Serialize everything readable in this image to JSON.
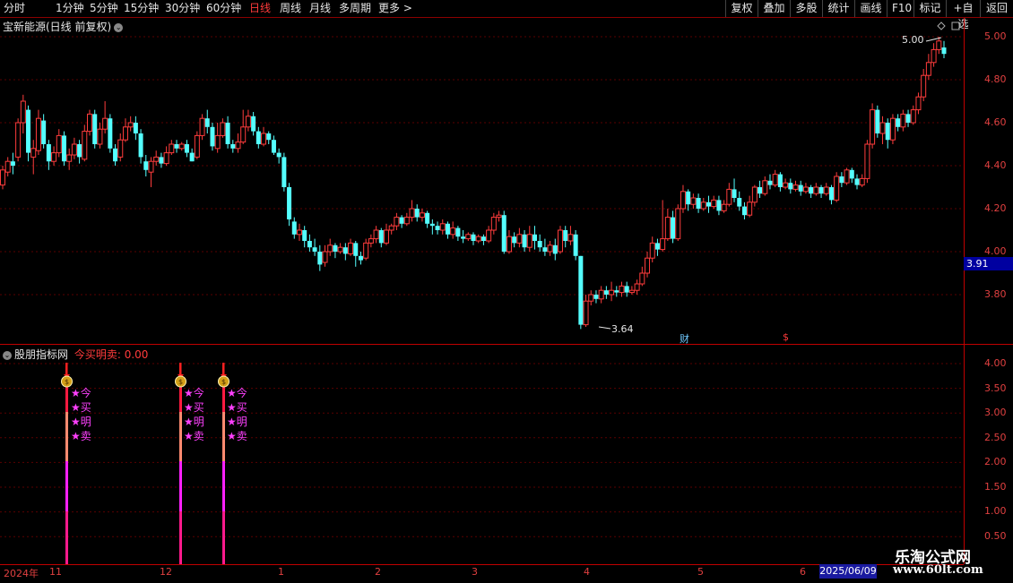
{
  "toolbar": {
    "periods": [
      "分时",
      "1分钟",
      "5分钟",
      "15分钟",
      "30分钟",
      "60分钟",
      "日线",
      "周线",
      "月线",
      "多周期",
      "更多 >"
    ],
    "active_period": "日线",
    "right_buttons": [
      "复权",
      "叠加",
      "多股",
      "统计",
      "画线",
      "F10",
      "标记",
      "+自选",
      "返回"
    ]
  },
  "main_chart": {
    "title": "宝新能源(日线 前复权)",
    "price_axis": [
      "5.00",
      "4.80",
      "4.60",
      "4.40",
      "4.20",
      "4.00",
      "3.80"
    ],
    "current_price": "3.91",
    "high_label": "5.00",
    "low_label": "3.64",
    "markers": {
      "cai": "财",
      "dollar": "$"
    },
    "colors": {
      "up": "#ff3c3c",
      "down": "#54ffff",
      "grid": "#5a0000",
      "axis": "#e04040"
    }
  },
  "indicator": {
    "name": "股朋指标网",
    "label": "今买明卖: 0.00",
    "axis": [
      "4.00",
      "3.50",
      "3.00",
      "2.50",
      "2.00",
      "1.50",
      "1.00",
      "0.50"
    ],
    "signal_chars": [
      "★今",
      "★买",
      "★明",
      "★卖"
    ]
  },
  "date_axis": {
    "year": "2024年",
    "months": [
      "11",
      "12",
      "1",
      "2",
      "3",
      "4",
      "5",
      "6"
    ],
    "current_date": "2025/06/09"
  },
  "watermark": {
    "line1": "乐淘公式网",
    "line2": "www.60lt.com"
  },
  "chart_data": {
    "type": "candlestick",
    "ylim": [
      3.55,
      5.05
    ],
    "candles": [
      [
        4.31,
        4.38,
        4.29,
        4.4
      ],
      [
        4.37,
        4.42,
        4.35,
        4.44
      ],
      [
        4.42,
        4.4,
        4.36,
        4.46
      ],
      [
        4.44,
        4.6,
        4.42,
        4.62
      ],
      [
        4.6,
        4.7,
        4.55,
        4.73
      ],
      [
        4.66,
        4.46,
        4.42,
        4.68
      ],
      [
        4.44,
        4.48,
        4.36,
        4.52
      ],
      [
        4.47,
        4.62,
        4.45,
        4.66
      ],
      [
        4.61,
        4.5,
        4.48,
        4.64
      ],
      [
        4.5,
        4.42,
        4.38,
        4.52
      ],
      [
        4.42,
        4.46,
        4.4,
        4.49
      ],
      [
        4.46,
        4.54,
        4.44,
        4.57
      ],
      [
        4.54,
        4.42,
        4.4,
        4.56
      ],
      [
        4.42,
        4.45,
        4.38,
        4.48
      ],
      [
        4.45,
        4.5,
        4.43,
        4.53
      ],
      [
        4.5,
        4.44,
        4.41,
        4.52
      ],
      [
        4.43,
        4.56,
        4.42,
        4.59
      ],
      [
        4.56,
        4.64,
        4.54,
        4.66
      ],
      [
        4.64,
        4.5,
        4.48,
        4.66
      ],
      [
        4.5,
        4.57,
        4.48,
        4.6
      ],
      [
        4.57,
        4.62,
        4.55,
        4.7
      ],
      [
        4.62,
        4.48,
        4.46,
        4.64
      ],
      [
        4.48,
        4.42,
        4.4,
        4.5
      ],
      [
        4.44,
        4.52,
        4.42,
        4.55
      ],
      [
        4.52,
        4.58,
        4.51,
        4.62
      ],
      [
        4.58,
        4.6,
        4.56,
        4.63
      ],
      [
        4.6,
        4.55,
        4.52,
        4.63
      ],
      [
        4.55,
        4.44,
        4.41,
        4.57
      ],
      [
        4.42,
        4.38,
        4.35,
        4.45
      ],
      [
        4.37,
        4.42,
        4.3,
        4.44
      ],
      [
        4.42,
        4.44,
        4.4,
        4.47
      ],
      [
        4.44,
        4.41,
        4.39,
        4.46
      ],
      [
        4.41,
        4.46,
        4.4,
        4.49
      ],
      [
        4.46,
        4.5,
        4.45,
        4.52
      ],
      [
        4.5,
        4.48,
        4.46,
        4.52
      ],
      [
        4.48,
        4.5,
        4.47,
        4.51
      ],
      [
        4.5,
        4.46,
        4.44,
        4.52
      ],
      [
        4.46,
        4.42,
        4.42,
        4.48
      ],
      [
        4.44,
        4.54,
        4.43,
        4.56
      ],
      [
        4.54,
        4.62,
        4.52,
        4.64
      ],
      [
        4.62,
        4.58,
        4.55,
        4.66
      ],
      [
        4.58,
        4.49,
        4.47,
        4.6
      ],
      [
        4.48,
        4.54,
        4.46,
        4.6
      ],
      [
        4.54,
        4.6,
        4.53,
        4.62
      ],
      [
        4.6,
        4.5,
        4.48,
        4.63
      ],
      [
        4.5,
        4.48,
        4.46,
        4.52
      ],
      [
        4.48,
        4.51,
        4.46,
        4.55
      ],
      [
        4.51,
        4.58,
        4.5,
        4.66
      ],
      [
        4.58,
        4.63,
        4.56,
        4.66
      ],
      [
        4.63,
        4.56,
        4.54,
        4.65
      ],
      [
        4.56,
        4.5,
        4.48,
        4.58
      ],
      [
        4.5,
        4.55,
        4.49,
        4.58
      ],
      [
        4.55,
        4.52,
        4.5,
        4.56
      ],
      [
        4.52,
        4.46,
        4.45,
        4.54
      ],
      [
        4.46,
        4.44,
        4.41,
        4.48
      ],
      [
        4.44,
        4.3,
        4.28,
        4.46
      ],
      [
        4.3,
        4.15,
        4.12,
        4.32
      ],
      [
        4.14,
        4.08,
        4.06,
        4.16
      ],
      [
        4.08,
        4.1,
        4.05,
        4.13
      ],
      [
        4.1,
        4.05,
        4.02,
        4.12
      ],
      [
        4.05,
        4.02,
        4.0,
        4.08
      ],
      [
        4.02,
        4.0,
        3.98,
        4.06
      ],
      [
        4.0,
        3.94,
        3.91,
        4.03
      ],
      [
        3.95,
        4.0,
        3.93,
        4.03
      ],
      [
        4.0,
        4.03,
        3.98,
        4.06
      ],
      [
        4.03,
        4.0,
        3.97,
        4.04
      ],
      [
        4.0,
        4.02,
        3.99,
        4.04
      ],
      [
        4.02,
        3.99,
        3.96,
        4.04
      ],
      [
        3.99,
        4.04,
        3.98,
        4.06
      ],
      [
        4.04,
        3.98,
        3.93,
        4.05
      ],
      [
        3.98,
        3.96,
        3.94,
        4.0
      ],
      [
        3.97,
        4.04,
        3.96,
        4.06
      ],
      [
        4.04,
        4.06,
        4.02,
        4.08
      ],
      [
        4.06,
        4.1,
        4.04,
        4.12
      ],
      [
        4.1,
        4.04,
        4.02,
        4.11
      ],
      [
        4.04,
        4.1,
        4.03,
        4.13
      ],
      [
        4.1,
        4.12,
        4.08,
        4.13
      ],
      [
        4.12,
        4.16,
        4.1,
        4.18
      ],
      [
        4.16,
        4.13,
        4.11,
        4.17
      ],
      [
        4.13,
        4.16,
        4.12,
        4.18
      ],
      [
        4.16,
        4.2,
        4.14,
        4.24
      ],
      [
        4.2,
        4.16,
        4.14,
        4.22
      ],
      [
        4.16,
        4.18,
        4.14,
        4.2
      ],
      [
        4.18,
        4.13,
        4.11,
        4.19
      ],
      [
        4.13,
        4.12,
        4.08,
        4.15
      ],
      [
        4.12,
        4.1,
        4.08,
        4.14
      ],
      [
        4.1,
        4.13,
        4.08,
        4.15
      ],
      [
        4.13,
        4.08,
        4.06,
        4.14
      ],
      [
        4.08,
        4.11,
        4.06,
        4.14
      ],
      [
        4.11,
        4.07,
        4.05,
        4.12
      ],
      [
        4.07,
        4.06,
        4.04,
        4.1
      ],
      [
        4.06,
        4.08,
        4.05,
        4.09
      ],
      [
        4.08,
        4.05,
        4.03,
        4.09
      ],
      [
        4.05,
        4.07,
        4.04,
        4.08
      ],
      [
        4.07,
        4.05,
        4.03,
        4.08
      ],
      [
        4.05,
        4.1,
        4.04,
        4.12
      ],
      [
        4.1,
        4.16,
        4.08,
        4.18
      ],
      [
        4.16,
        4.17,
        4.14,
        4.19
      ],
      [
        4.17,
        4.0,
        3.99,
        4.19
      ],
      [
        4.0,
        4.07,
        3.99,
        4.1
      ],
      [
        4.07,
        4.04,
        4.02,
        4.09
      ],
      [
        4.04,
        4.08,
        4.02,
        4.11
      ],
      [
        4.08,
        4.02,
        4.0,
        4.1
      ],
      [
        4.02,
        4.08,
        4.0,
        4.12
      ],
      [
        4.08,
        4.05,
        4.01,
        4.12
      ],
      [
        4.05,
        4.02,
        4.0,
        4.08
      ],
      [
        4.02,
        4.0,
        3.98,
        4.06
      ],
      [
        4.0,
        4.03,
        3.98,
        4.05
      ],
      [
        4.03,
        3.99,
        3.96,
        4.06
      ],
      [
        4.0,
        4.1,
        3.99,
        4.12
      ],
      [
        4.1,
        4.05,
        4.02,
        4.12
      ],
      [
        4.05,
        4.08,
        4.03,
        4.12
      ],
      [
        4.08,
        3.98,
        3.96,
        4.1
      ],
      [
        3.98,
        3.66,
        3.64,
        3.98
      ],
      [
        3.66,
        3.77,
        3.65,
        3.8
      ],
      [
        3.77,
        3.8,
        3.75,
        3.82
      ],
      [
        3.8,
        3.78,
        3.76,
        3.82
      ],
      [
        3.78,
        3.82,
        3.76,
        3.84
      ],
      [
        3.82,
        3.8,
        3.78,
        3.84
      ],
      [
        3.8,
        3.82,
        3.77,
        3.86
      ],
      [
        3.82,
        3.81,
        3.79,
        3.84
      ],
      [
        3.81,
        3.84,
        3.79,
        3.86
      ],
      [
        3.84,
        3.81,
        3.79,
        3.86
      ],
      [
        3.81,
        3.82,
        3.8,
        3.84
      ],
      [
        3.82,
        3.85,
        3.8,
        3.87
      ],
      [
        3.85,
        3.9,
        3.84,
        3.93
      ],
      [
        3.9,
        3.97,
        3.88,
        4.0
      ],
      [
        3.97,
        4.04,
        3.95,
        4.07
      ],
      [
        4.04,
        4.01,
        3.98,
        4.06
      ],
      [
        4.01,
        4.06,
        4.0,
        4.24
      ],
      [
        4.06,
        4.16,
        4.05,
        4.2
      ],
      [
        4.16,
        4.06,
        4.04,
        4.19
      ],
      [
        4.06,
        4.2,
        4.05,
        4.22
      ],
      [
        4.2,
        4.28,
        4.18,
        4.31
      ],
      [
        4.28,
        4.22,
        4.19,
        4.29
      ],
      [
        4.22,
        4.25,
        4.2,
        4.27
      ],
      [
        4.25,
        4.2,
        4.18,
        4.27
      ],
      [
        4.2,
        4.23,
        4.19,
        4.25
      ],
      [
        4.23,
        4.21,
        4.18,
        4.26
      ],
      [
        4.21,
        4.24,
        4.2,
        4.26
      ],
      [
        4.24,
        4.19,
        4.17,
        4.26
      ],
      [
        4.19,
        4.22,
        4.18,
        4.24
      ],
      [
        4.22,
        4.29,
        4.21,
        4.32
      ],
      [
        4.29,
        4.25,
        4.23,
        4.34
      ],
      [
        4.25,
        4.21,
        4.19,
        4.28
      ],
      [
        4.21,
        4.17,
        4.15,
        4.23
      ],
      [
        4.17,
        4.23,
        4.16,
        4.26
      ],
      [
        4.23,
        4.3,
        4.21,
        4.31
      ],
      [
        4.3,
        4.27,
        4.25,
        4.33
      ],
      [
        4.27,
        4.33,
        4.26,
        4.35
      ],
      [
        4.33,
        4.31,
        4.29,
        4.36
      ],
      [
        4.31,
        4.36,
        4.3,
        4.38
      ],
      [
        4.36,
        4.3,
        4.28,
        4.37
      ],
      [
        4.3,
        4.32,
        4.29,
        4.34
      ],
      [
        4.32,
        4.29,
        4.27,
        4.34
      ],
      [
        4.29,
        4.31,
        4.28,
        4.33
      ],
      [
        4.31,
        4.28,
        4.26,
        4.33
      ],
      [
        4.28,
        4.3,
        4.27,
        4.32
      ],
      [
        4.3,
        4.27,
        4.25,
        4.31
      ],
      [
        4.27,
        4.3,
        4.26,
        4.32
      ],
      [
        4.3,
        4.27,
        4.25,
        4.31
      ],
      [
        4.27,
        4.3,
        4.26,
        4.32
      ],
      [
        4.3,
        4.24,
        4.22,
        4.31
      ],
      [
        4.24,
        4.35,
        4.23,
        4.37
      ],
      [
        4.35,
        4.32,
        4.3,
        4.37
      ],
      [
        4.32,
        4.38,
        4.31,
        4.39
      ],
      [
        4.38,
        4.34,
        4.32,
        4.39
      ],
      [
        4.34,
        4.31,
        4.29,
        4.36
      ],
      [
        4.31,
        4.34,
        4.3,
        4.36
      ],
      [
        4.34,
        4.5,
        4.32,
        4.52
      ],
      [
        4.5,
        4.66,
        4.48,
        4.69
      ],
      [
        4.66,
        4.55,
        4.53,
        4.68
      ],
      [
        4.55,
        4.6,
        4.5,
        4.63
      ],
      [
        4.6,
        4.52,
        4.48,
        4.62
      ],
      [
        4.52,
        4.62,
        4.5,
        4.64
      ],
      [
        4.62,
        4.58,
        4.56,
        4.64
      ],
      [
        4.58,
        4.64,
        4.56,
        4.66
      ],
      [
        4.64,
        4.6,
        4.58,
        4.66
      ],
      [
        4.6,
        4.66,
        4.59,
        4.68
      ],
      [
        4.66,
        4.72,
        4.64,
        4.74
      ],
      [
        4.72,
        4.82,
        4.7,
        4.85
      ],
      [
        4.82,
        4.88,
        4.8,
        4.92
      ],
      [
        4.88,
        4.94,
        4.86,
        4.97
      ],
      [
        4.94,
        4.98,
        4.92,
        5.0
      ],
      [
        4.95,
        4.92,
        4.9,
        4.98
      ]
    ],
    "signals": [
      73,
      200,
      248
    ]
  }
}
